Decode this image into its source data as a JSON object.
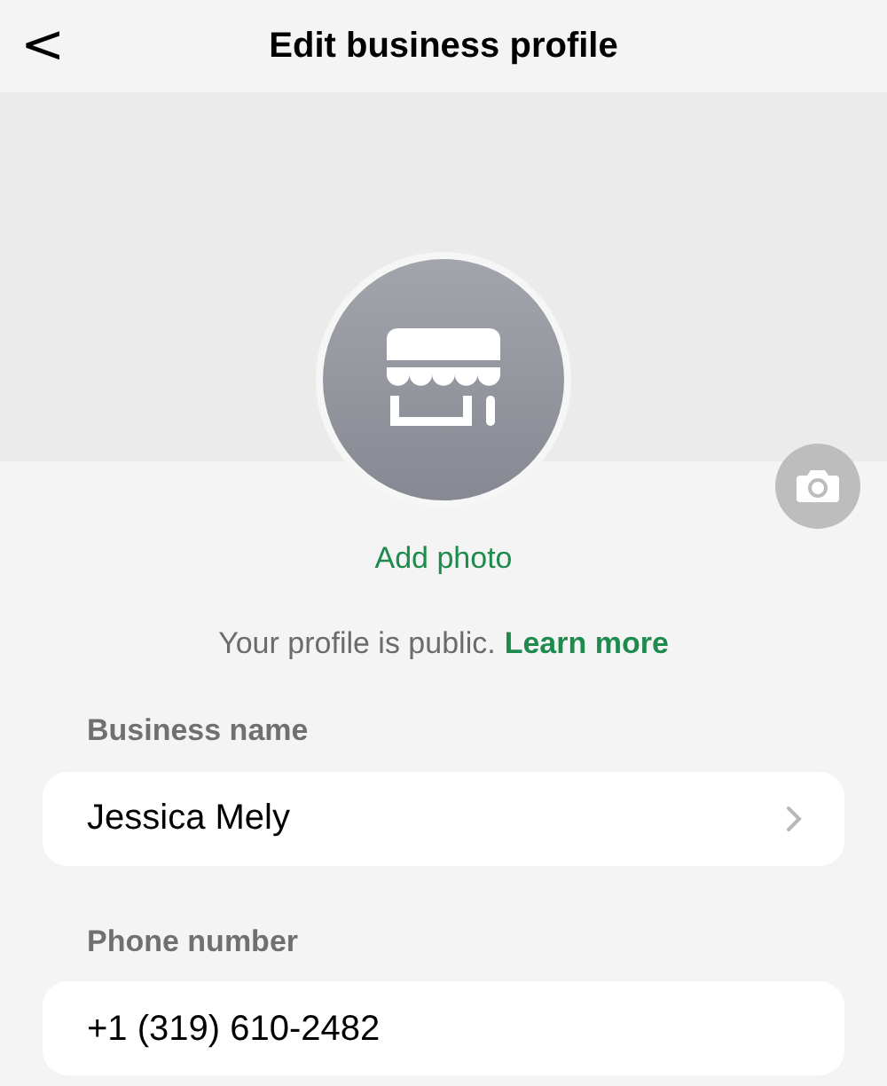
{
  "header": {
    "back": "<",
    "title": "Edit business profile"
  },
  "profile": {
    "add_photo": "Add photo",
    "notice": "Your profile is public.",
    "learn_more": "Learn more"
  },
  "fields": [
    {
      "label": "Business name",
      "value": "Jessica Mely",
      "kind": "link"
    },
    {
      "label": "Phone number",
      "value": "+1 (319) 610-2482",
      "kind": "text"
    }
  ]
}
